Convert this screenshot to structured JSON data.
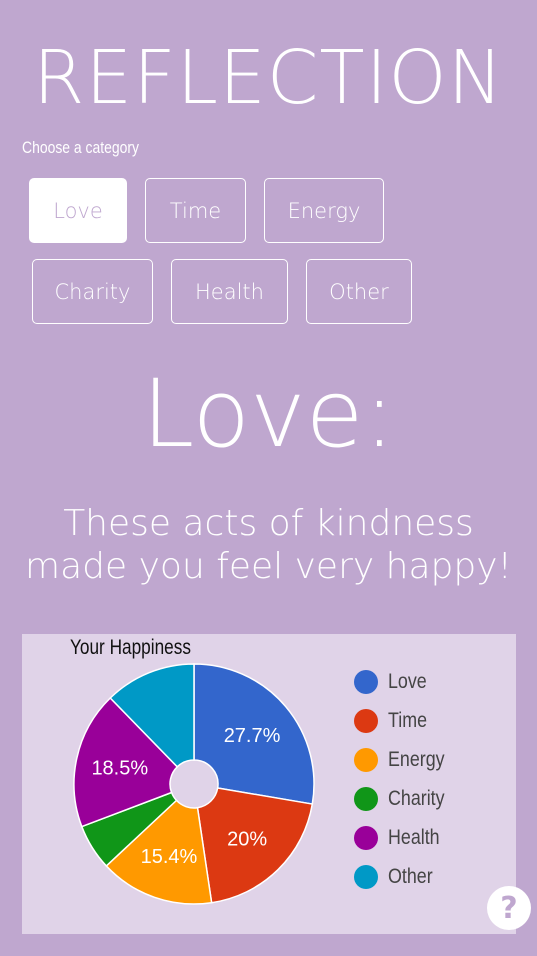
{
  "app": {
    "title": "REFLECTION"
  },
  "categories": {
    "label": "Choose a category",
    "items": [
      "Love",
      "Time",
      "Energy",
      "Charity",
      "Health",
      "Other"
    ],
    "selected": "Love"
  },
  "result": {
    "heading": "Love:",
    "message_line1": "These acts of kindness",
    "message_line2": "made you feel very happy!"
  },
  "chart_data": {
    "type": "pie",
    "title": "Your Happiness",
    "categories": [
      "Love",
      "Time",
      "Energy",
      "Charity",
      "Health",
      "Other"
    ],
    "values": [
      27.7,
      20,
      15.4,
      6.2,
      18.5,
      12.3
    ],
    "data_labels": [
      "27.7%",
      "20%",
      "15.4%",
      "",
      "18.5%",
      ""
    ],
    "colors": [
      "#3366cc",
      "#dc3912",
      "#ff9900",
      "#109618",
      "#990099",
      "#0099c6"
    ],
    "legend": "right"
  },
  "help": {
    "label": "?"
  },
  "colors": {
    "background": "#bfa7cf",
    "panel": "#e0d3e8",
    "text": "#ffffff"
  }
}
